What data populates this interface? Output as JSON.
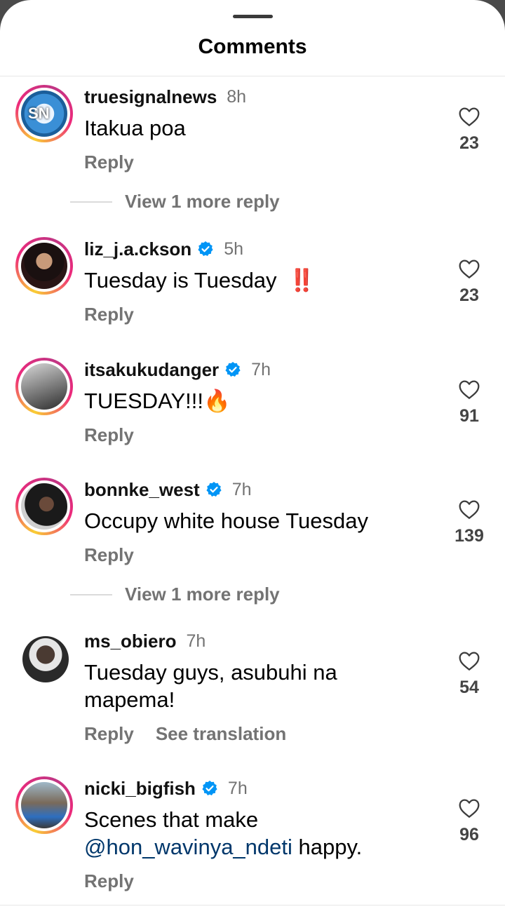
{
  "sheet": {
    "title": "Comments"
  },
  "comments": [
    {
      "username": "truesignalnews",
      "verified": false,
      "time": "8h",
      "text": "Itakua poa",
      "likes": "23",
      "reply_label": "Reply",
      "view_more": "View 1 more reply",
      "avatar_text": "SN"
    },
    {
      "username": "liz_j.a.ckson",
      "verified": true,
      "time": "5h",
      "text": "Tuesday is Tuesday",
      "emoji": "‼️",
      "likes": "23",
      "reply_label": "Reply"
    },
    {
      "username": "itsakukudanger",
      "verified": true,
      "time": "7h",
      "text": "TUESDAY!!!🔥",
      "likes": "91",
      "reply_label": "Reply"
    },
    {
      "username": "bonnke_west",
      "verified": true,
      "time": "7h",
      "text": "Occupy white house Tuesday",
      "likes": "139",
      "reply_label": "Reply",
      "view_more": "View 1 more reply"
    },
    {
      "username": "ms_obiero",
      "verified": false,
      "time": "7h",
      "text": "Tuesday guys, asubuhi na mapema!",
      "likes": "54",
      "reply_label": "Reply",
      "translation_label": "See translation"
    },
    {
      "username": "nicki_bigfish",
      "verified": true,
      "time": "7h",
      "text_before": "Scenes that make ",
      "mention": "@hon_wavinya_ndeti",
      "text_after": " happy.",
      "likes": "96",
      "reply_label": "Reply"
    }
  ],
  "icons": {
    "like": "heart-outline-icon",
    "verified": "verified-badge-icon"
  },
  "colors": {
    "verified_blue": "#0095f6",
    "secondary_text": "#737373",
    "mention": "#00376b"
  }
}
